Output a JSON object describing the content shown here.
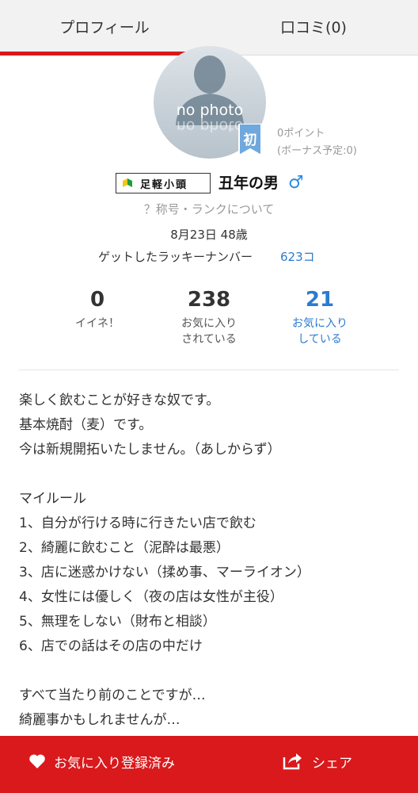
{
  "tabs": [
    {
      "label": "プロフィール"
    },
    {
      "label": "口コミ(0)"
    }
  ],
  "profile": {
    "avatar_text": "no photo",
    "badge": "初",
    "points": "0ポイント",
    "bonus": "(ボーナス予定:0)",
    "rank_title": "足軽小頭",
    "username": "丑年の男",
    "gender_symbol": "♂",
    "rank_link": "？称号・ランクについて",
    "birth_age": "8月23日 48歳",
    "lucky_label": "ゲットしたラッキーナンバー",
    "lucky_value": "623コ"
  },
  "stats": [
    {
      "value": "0",
      "label": "イイネ！"
    },
    {
      "value": "238",
      "label": "お気に入り\nされている"
    },
    {
      "value": "21",
      "label": "お気に入り\nしている"
    }
  ],
  "description": "楽しく飲むことが好きな奴です。\n基本焼酎（麦）です。\n今は新規開拓いたしません。（あしからず）\n\nマイルール\n1、自分が行ける時に行きたい店で飲む\n2、綺麗に飲むこと（泥酔は最悪）\n3、店に迷惑かけない（揉め事、マーライオン）\n4、女性には優しく（夜の店は女性が主役）\n5、無理をしない（財布と相談）\n6、店での話はその店の中だけ\n\nすべて当たり前のことですが…\n綺麗事かもしれませんが…",
  "footer": {
    "favorite_label": "お気に入り登録済み",
    "share_label": "シェア"
  },
  "colors": {
    "accent": "#d9191c",
    "link": "#2b7bd0",
    "badge": "#6fa8dc"
  },
  "icons": {
    "badge": "ribbon-badge-icon",
    "gender": "male-icon",
    "rank": "beginner-leaf-icon",
    "favorite": "heart-icon",
    "share": "share-icon"
  }
}
